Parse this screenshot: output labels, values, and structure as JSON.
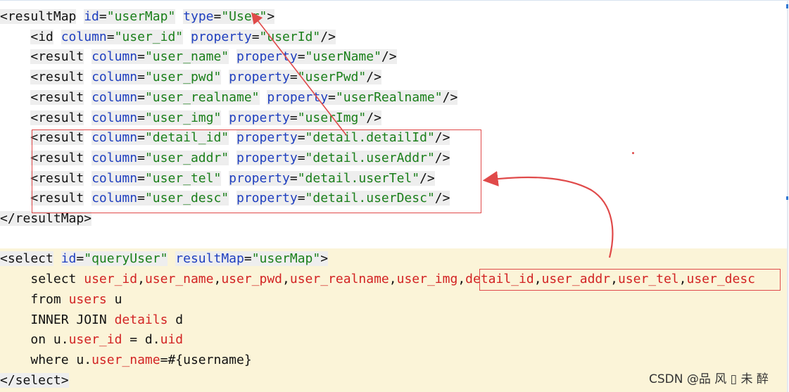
{
  "editor": {
    "lines": [
      {
        "hl": true,
        "tokens": [
          {
            "t": "<resultMap",
            "c": "tag"
          },
          {
            "t": " ",
            "c": "txt"
          },
          {
            "t": "id",
            "c": "attr"
          },
          {
            "t": "=",
            "c": "txt"
          },
          {
            "t": "\"userMap\"",
            "c": "str"
          },
          {
            "t": " ",
            "c": "txt"
          },
          {
            "t": "type",
            "c": "attr"
          },
          {
            "t": "=",
            "c": "txt"
          },
          {
            "t": "\"User\"",
            "c": "str"
          },
          {
            "t": ">",
            "c": "tag"
          }
        ]
      },
      {
        "hl": true,
        "tokens": [
          {
            "t": "    ",
            "c": "txt"
          },
          {
            "t": "<id",
            "c": "tag"
          },
          {
            "t": " ",
            "c": "txt"
          },
          {
            "t": "column",
            "c": "attr"
          },
          {
            "t": "=",
            "c": "txt"
          },
          {
            "t": "\"user_id\"",
            "c": "str"
          },
          {
            "t": " ",
            "c": "txt"
          },
          {
            "t": "property",
            "c": "attr"
          },
          {
            "t": "=",
            "c": "txt"
          },
          {
            "t": "\"userId\"",
            "c": "str"
          },
          {
            "t": "/>",
            "c": "tag"
          }
        ]
      },
      {
        "hl": true,
        "tokens": [
          {
            "t": "    ",
            "c": "txt"
          },
          {
            "t": "<result",
            "c": "tag"
          },
          {
            "t": " ",
            "c": "txt"
          },
          {
            "t": "column",
            "c": "attr"
          },
          {
            "t": "=",
            "c": "txt"
          },
          {
            "t": "\"user_name\"",
            "c": "str"
          },
          {
            "t": " ",
            "c": "txt"
          },
          {
            "t": "property",
            "c": "attr"
          },
          {
            "t": "=",
            "c": "txt"
          },
          {
            "t": "\"userName\"",
            "c": "str"
          },
          {
            "t": "/>",
            "c": "tag"
          }
        ]
      },
      {
        "hl": true,
        "tokens": [
          {
            "t": "    ",
            "c": "txt"
          },
          {
            "t": "<result",
            "c": "tag"
          },
          {
            "t": " ",
            "c": "txt"
          },
          {
            "t": "column",
            "c": "attr"
          },
          {
            "t": "=",
            "c": "txt"
          },
          {
            "t": "\"user_pwd\"",
            "c": "str"
          },
          {
            "t": " ",
            "c": "txt"
          },
          {
            "t": "property",
            "c": "attr"
          },
          {
            "t": "=",
            "c": "txt"
          },
          {
            "t": "\"userPwd\"",
            "c": "str"
          },
          {
            "t": "/>",
            "c": "tag"
          }
        ]
      },
      {
        "hl": true,
        "tokens": [
          {
            "t": "    ",
            "c": "txt"
          },
          {
            "t": "<result",
            "c": "tag"
          },
          {
            "t": " ",
            "c": "txt"
          },
          {
            "t": "column",
            "c": "attr"
          },
          {
            "t": "=",
            "c": "txt"
          },
          {
            "t": "\"user_realname\"",
            "c": "str"
          },
          {
            "t": " ",
            "c": "txt"
          },
          {
            "t": "property",
            "c": "attr"
          },
          {
            "t": "=",
            "c": "txt"
          },
          {
            "t": "\"userRealname\"",
            "c": "str"
          },
          {
            "t": "/>",
            "c": "tag"
          }
        ]
      },
      {
        "hl": true,
        "tokens": [
          {
            "t": "    ",
            "c": "txt"
          },
          {
            "t": "<result",
            "c": "tag"
          },
          {
            "t": " ",
            "c": "txt"
          },
          {
            "t": "column",
            "c": "attr"
          },
          {
            "t": "=",
            "c": "txt"
          },
          {
            "t": "\"user_img\"",
            "c": "str"
          },
          {
            "t": " ",
            "c": "txt"
          },
          {
            "t": "property",
            "c": "attr"
          },
          {
            "t": "=",
            "c": "txt"
          },
          {
            "t": "\"userImg\"",
            "c": "str"
          },
          {
            "t": "/>",
            "c": "tag"
          }
        ]
      },
      {
        "hl": true,
        "tokens": [
          {
            "t": "    ",
            "c": "txt"
          },
          {
            "t": "<result",
            "c": "tag"
          },
          {
            "t": " ",
            "c": "txt"
          },
          {
            "t": "column",
            "c": "attr"
          },
          {
            "t": "=",
            "c": "txt"
          },
          {
            "t": "\"detail_id\"",
            "c": "str"
          },
          {
            "t": " ",
            "c": "txt"
          },
          {
            "t": "property",
            "c": "attr"
          },
          {
            "t": "=",
            "c": "txt"
          },
          {
            "t": "\"detail.detailId\"",
            "c": "str"
          },
          {
            "t": "/>",
            "c": "tag"
          }
        ]
      },
      {
        "hl": true,
        "tokens": [
          {
            "t": "    ",
            "c": "txt"
          },
          {
            "t": "<result",
            "c": "tag"
          },
          {
            "t": " ",
            "c": "txt"
          },
          {
            "t": "column",
            "c": "attr"
          },
          {
            "t": "=",
            "c": "txt"
          },
          {
            "t": "\"user_addr\"",
            "c": "str"
          },
          {
            "t": " ",
            "c": "txt"
          },
          {
            "t": "property",
            "c": "attr"
          },
          {
            "t": "=",
            "c": "txt"
          },
          {
            "t": "\"detail.userAddr\"",
            "c": "str"
          },
          {
            "t": "/>",
            "c": "tag"
          }
        ]
      },
      {
        "hl": true,
        "tokens": [
          {
            "t": "    ",
            "c": "txt"
          },
          {
            "t": "<result",
            "c": "tag"
          },
          {
            "t": " ",
            "c": "txt"
          },
          {
            "t": "column",
            "c": "attr"
          },
          {
            "t": "=",
            "c": "txt"
          },
          {
            "t": "\"user_tel\"",
            "c": "str"
          },
          {
            "t": " ",
            "c": "txt"
          },
          {
            "t": "property",
            "c": "attr"
          },
          {
            "t": "=",
            "c": "txt"
          },
          {
            "t": "\"detail.userTel\"",
            "c": "str"
          },
          {
            "t": "/>",
            "c": "tag"
          }
        ]
      },
      {
        "hl": true,
        "tokens": [
          {
            "t": "    ",
            "c": "txt"
          },
          {
            "t": "<result",
            "c": "tag"
          },
          {
            "t": " ",
            "c": "txt"
          },
          {
            "t": "column",
            "c": "attr"
          },
          {
            "t": "=",
            "c": "txt"
          },
          {
            "t": "\"user_desc\"",
            "c": "str"
          },
          {
            "t": " ",
            "c": "txt"
          },
          {
            "t": "property",
            "c": "attr"
          },
          {
            "t": "=",
            "c": "txt"
          },
          {
            "t": "\"detail.userDesc\"",
            "c": "str"
          },
          {
            "t": "/>",
            "c": "tag"
          }
        ]
      },
      {
        "hl": true,
        "tokens": [
          {
            "t": "</resultMap>",
            "c": "tag"
          }
        ]
      },
      {
        "hl": false,
        "tokens": [
          {
            "t": "",
            "c": "txt"
          }
        ]
      },
      {
        "hl": true,
        "tokens": [
          {
            "t": "<select",
            "c": "tag"
          },
          {
            "t": " ",
            "c": "txt"
          },
          {
            "t": "id",
            "c": "attr"
          },
          {
            "t": "=",
            "c": "txt"
          },
          {
            "t": "\"queryUser\"",
            "c": "str"
          },
          {
            "t": " ",
            "c": "txt"
          },
          {
            "t": "resultMap",
            "c": "attr"
          },
          {
            "t": "=",
            "c": "txt"
          },
          {
            "t": "\"userMap\"",
            "c": "str"
          },
          {
            "t": ">",
            "c": "tag"
          }
        ]
      },
      {
        "hl": false,
        "tokens": [
          {
            "t": "    ",
            "c": "txt"
          },
          {
            "t": "select",
            "c": "kw"
          },
          {
            "t": " ",
            "c": "txt"
          },
          {
            "t": "user_id",
            "c": "tbl"
          },
          {
            "t": ",",
            "c": "txt"
          },
          {
            "t": "user_name",
            "c": "tbl"
          },
          {
            "t": ",",
            "c": "txt"
          },
          {
            "t": "user_pwd",
            "c": "tbl"
          },
          {
            "t": ",",
            "c": "txt"
          },
          {
            "t": "user_realname",
            "c": "tbl"
          },
          {
            "t": ",",
            "c": "txt"
          },
          {
            "t": "user_img",
            "c": "tbl"
          },
          {
            "t": ",",
            "c": "txt"
          },
          {
            "t": "detail_id",
            "c": "tbl"
          },
          {
            "t": ",",
            "c": "txt"
          },
          {
            "t": "user_addr",
            "c": "tbl"
          },
          {
            "t": ",",
            "c": "txt"
          },
          {
            "t": "user_tel",
            "c": "tbl"
          },
          {
            "t": ",",
            "c": "txt"
          },
          {
            "t": "user_desc",
            "c": "tbl"
          }
        ]
      },
      {
        "hl": false,
        "tokens": [
          {
            "t": "    ",
            "c": "txt"
          },
          {
            "t": "from",
            "c": "kw"
          },
          {
            "t": " ",
            "c": "txt"
          },
          {
            "t": "users",
            "c": "tbl"
          },
          {
            "t": " u",
            "c": "txt"
          }
        ]
      },
      {
        "hl": false,
        "tokens": [
          {
            "t": "    ",
            "c": "txt"
          },
          {
            "t": "INNER JOIN",
            "c": "kw"
          },
          {
            "t": " ",
            "c": "txt"
          },
          {
            "t": "details",
            "c": "tbl"
          },
          {
            "t": " d",
            "c": "txt"
          }
        ]
      },
      {
        "hl": false,
        "tokens": [
          {
            "t": "    ",
            "c": "txt"
          },
          {
            "t": "on",
            "c": "kw"
          },
          {
            "t": " u.",
            "c": "txt"
          },
          {
            "t": "user_id",
            "c": "tbl"
          },
          {
            "t": " = d.",
            "c": "txt"
          },
          {
            "t": "uid",
            "c": "tbl"
          }
        ]
      },
      {
        "hl": false,
        "tokens": [
          {
            "t": "    ",
            "c": "txt"
          },
          {
            "t": "where",
            "c": "kw"
          },
          {
            "t": " u.",
            "c": "txt"
          },
          {
            "t": "user_name",
            "c": "tbl"
          },
          {
            "t": "=#{username}",
            "c": "txt"
          }
        ]
      },
      {
        "hl": true,
        "tokens": [
          {
            "t": "</select>",
            "c": "tag"
          }
        ]
      }
    ]
  },
  "watermark": "CSDN @品 风 ▯ 未 醉",
  "colors": {
    "tag": "#111111",
    "attribute": "#1f3fbf",
    "string": "#1a7f1a",
    "sql_identifier": "#d22323",
    "annotation": "#e04a4a",
    "sql_background": "#fbf4d8"
  }
}
